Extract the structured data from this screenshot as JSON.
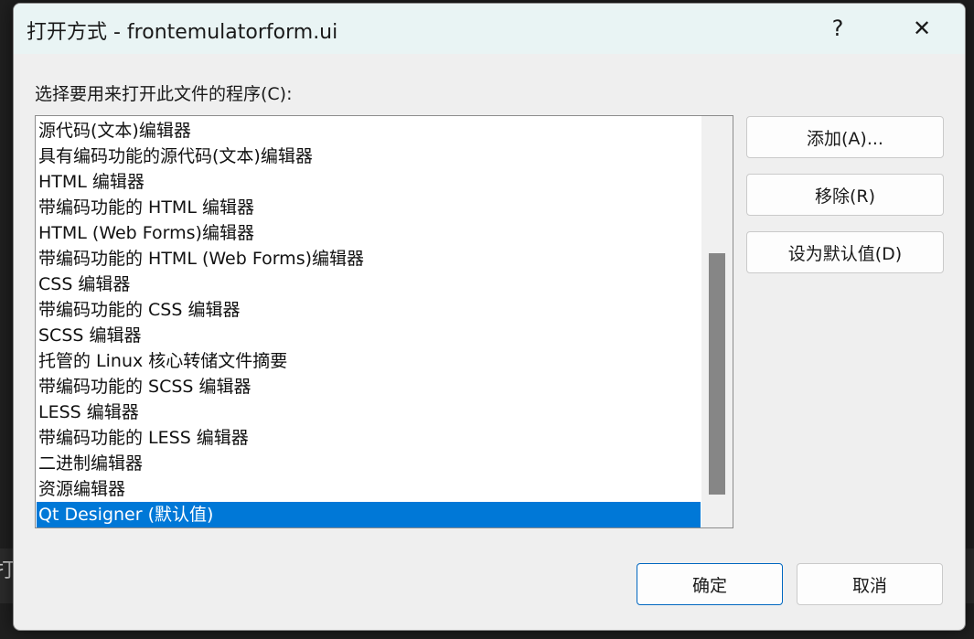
{
  "background": {
    "partial_text": "打"
  },
  "dialog": {
    "title": "打开方式 - frontemulatorform.ui",
    "help_icon": "?",
    "close_icon": "✕",
    "prompt": "选择要用来打开此文件的程序(C):",
    "programs": [
      "源代码(文本)编辑器",
      "具有编码功能的源代码(文本)编辑器",
      "HTML 编辑器",
      "带编码功能的 HTML 编辑器",
      "HTML (Web Forms)编辑器",
      "带编码功能的 HTML (Web Forms)编辑器",
      "CSS 编辑器",
      "带编码功能的 CSS 编辑器",
      "SCSS 编辑器",
      "托管的 Linux 核心转储文件摘要",
      "带编码功能的 SCSS 编辑器",
      "LESS 编辑器",
      "带编码功能的 LESS 编辑器",
      "二进制编辑器",
      "资源编辑器",
      "Qt Designer (默认值)"
    ],
    "selected_program": "Qt Designer (默认值)",
    "buttons": {
      "add": "添加(A)...",
      "remove": "移除(R)",
      "set_default": "设为默认值(D)",
      "ok": "确定",
      "cancel": "取消"
    }
  },
  "colors": {
    "selection": "#0078d7",
    "title_bar": "#e9f4f4",
    "dialog_body": "#efefef",
    "ok_border": "#0067c0"
  }
}
